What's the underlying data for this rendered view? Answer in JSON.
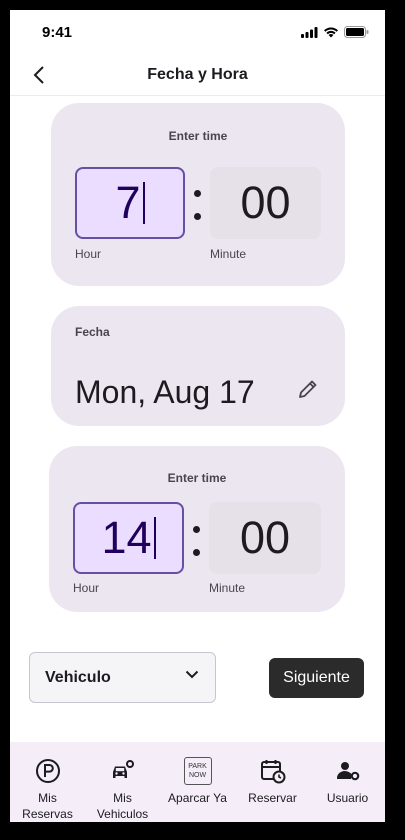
{
  "status_bar": {
    "time": "9:41"
  },
  "header": {
    "title": "Fecha y Hora"
  },
  "start_time": {
    "label": "Enter time",
    "hour": "7",
    "minute": "00",
    "hour_label": "Hour",
    "minute_label": "Minute"
  },
  "date": {
    "label": "Fecha",
    "value": "Mon, Aug 17"
  },
  "end_time": {
    "label": "Enter time",
    "hour": "14",
    "minute": "00",
    "hour_label": "Hour",
    "minute_label": "Minute"
  },
  "vehicle_select": {
    "selected": "Vehiculo"
  },
  "next_button": {
    "label": "Siguiente"
  },
  "tab_bar": {
    "tabs": [
      {
        "label": "Mis\nReservas",
        "icon": "parking-icon"
      },
      {
        "label": "Mis\nVehiculos",
        "icon": "car-gear-icon"
      },
      {
        "label": "Aparcar Ya",
        "icon": "park-now-icon",
        "badge": "PARK NOW"
      },
      {
        "label": "Reservar",
        "icon": "calendar-clock-icon"
      },
      {
        "label": "Usuario",
        "icon": "user-settings-icon"
      }
    ]
  }
}
